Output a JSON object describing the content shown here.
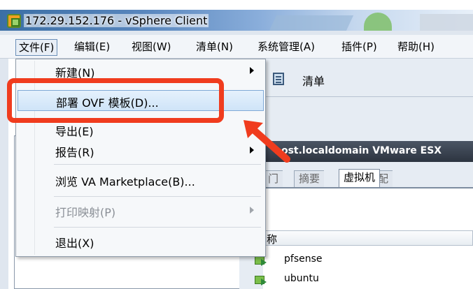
{
  "window": {
    "title": "172.29.152.176 - vSphere Client"
  },
  "menubar": {
    "items": [
      {
        "label": "文件(F)"
      },
      {
        "label": "编辑(E)"
      },
      {
        "label": "视图(W)"
      },
      {
        "label": "清单(N)"
      },
      {
        "label": "系统管理(A)"
      },
      {
        "label": "插件(P)"
      },
      {
        "label": "帮助(H)"
      }
    ]
  },
  "toolbar": {
    "inventory_label": "清单"
  },
  "host": {
    "title": "host.localdomain VMware ESX"
  },
  "tabs": [
    {
      "label": "门"
    },
    {
      "label": "摘要"
    },
    {
      "label": "虚拟机",
      "selected": true
    },
    {
      "label": "资源分配"
    }
  ],
  "vm_list": {
    "column_header": "称",
    "items": [
      {
        "name": "pfsense"
      },
      {
        "name": "ubuntu"
      }
    ]
  },
  "file_menu": {
    "items": [
      {
        "label": "新建(N)",
        "submenu": true,
        "enabled": true
      },
      {
        "label": "部署 OVF 模板(D)...",
        "submenu": false,
        "enabled": true,
        "highlighted": true
      },
      {
        "label": "导出(E)",
        "submenu": true,
        "enabled": true
      },
      {
        "label": "报告(R)",
        "submenu": true,
        "enabled": true
      },
      {
        "label": "浏览 VA Marketplace(B)...",
        "submenu": false,
        "enabled": true
      },
      {
        "label": "打印映射(P)",
        "submenu": true,
        "enabled": false
      },
      {
        "label": "退出(X)",
        "submenu": false,
        "enabled": true
      }
    ]
  },
  "colors": {
    "annotation_red": "#f03c1e",
    "highlight_blue": "#cfe4f8",
    "host_bar": "#2d3440"
  },
  "icons": {
    "app": "vsphere-app-icon",
    "inventory": "inventory-icon",
    "vm": "vm-running-icon"
  }
}
